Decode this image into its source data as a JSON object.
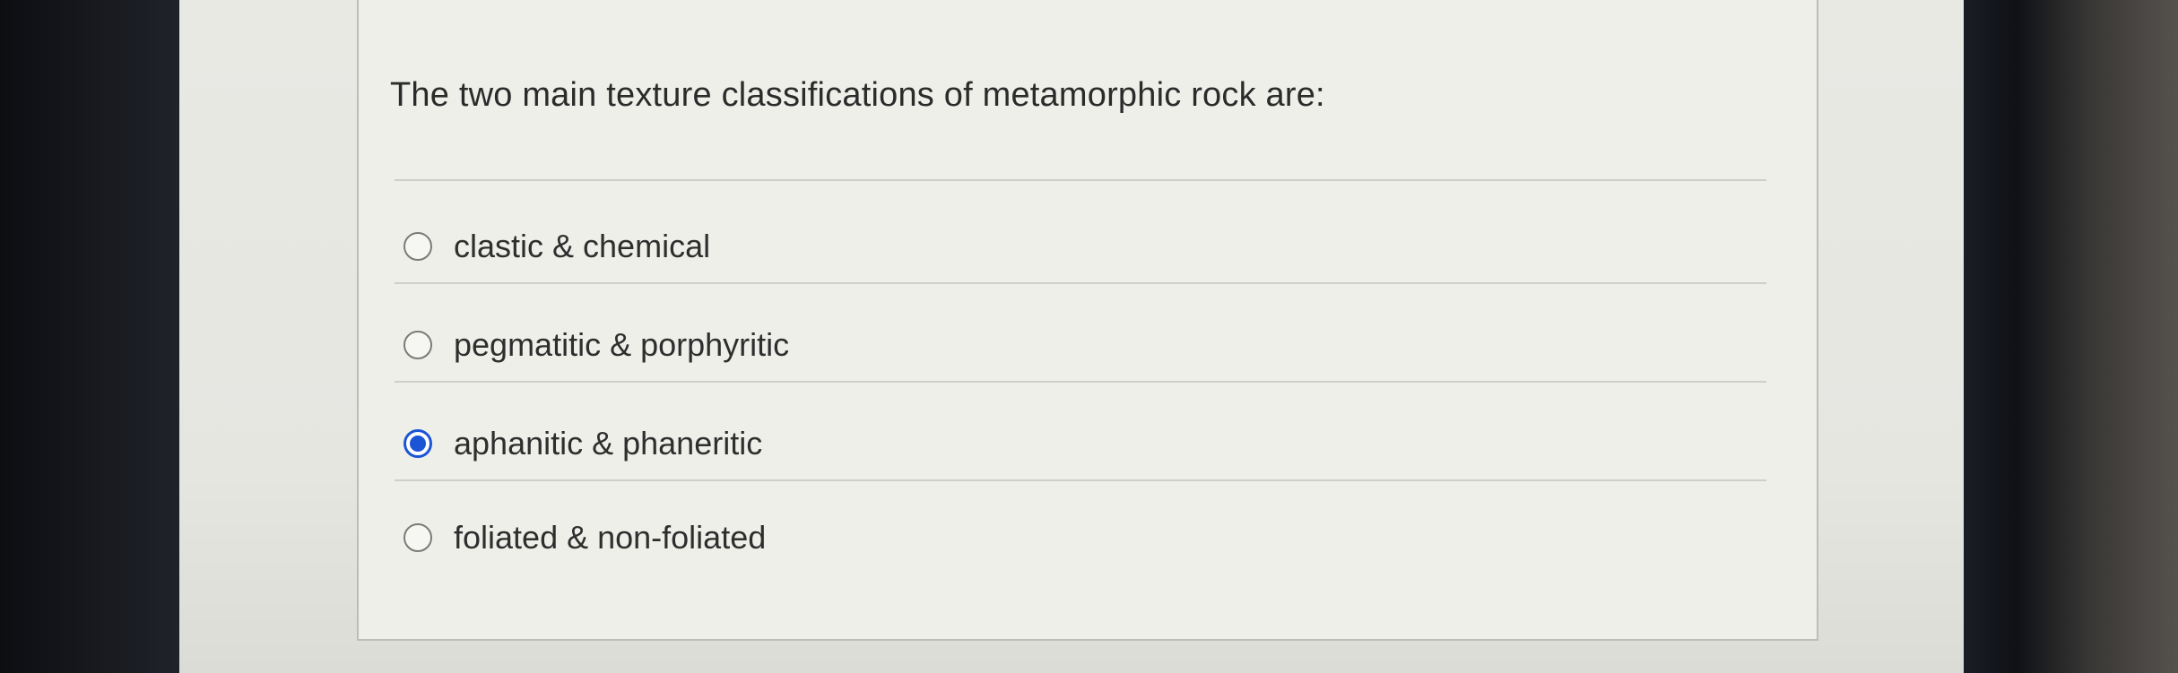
{
  "question": {
    "text": "The two main texture classifications of metamorphic rock are:"
  },
  "options": [
    {
      "label": "clastic & chemical",
      "selected": false
    },
    {
      "label": "pegmatitic & porphyritic",
      "selected": false
    },
    {
      "label": "aphanitic & phaneritic",
      "selected": true
    },
    {
      "label": "foliated & non-foliated",
      "selected": false
    }
  ],
  "colors": {
    "selected_radio": "#1b55d6",
    "text": "#2e2e2e"
  }
}
